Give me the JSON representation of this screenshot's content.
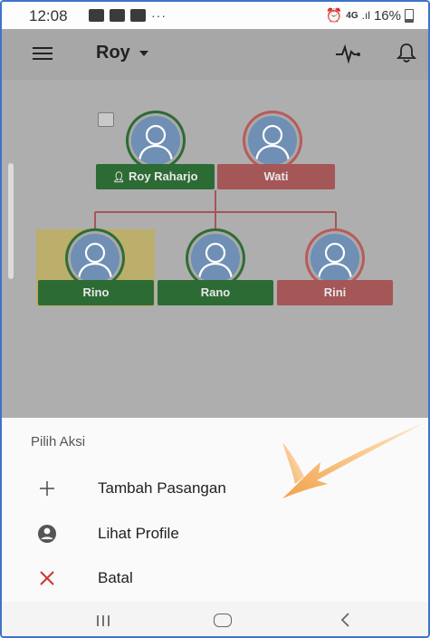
{
  "status_bar": {
    "time": "12:08",
    "network": "4G",
    "battery": "16%"
  },
  "app_bar": {
    "title": "Roy"
  },
  "tree": {
    "parents": [
      {
        "name": "Roy Raharjo",
        "color": "#2d6b35"
      },
      {
        "name": "Wati",
        "color": "#a55656"
      }
    ],
    "children": [
      {
        "name": "Rino",
        "color": "#2d6b35",
        "selected": true
      },
      {
        "name": "Rano",
        "color": "#2d6b35"
      },
      {
        "name": "Rini",
        "color": "#a55656"
      }
    ]
  },
  "sheet": {
    "title": "Pilih Aksi",
    "items": [
      {
        "label": "Tambah Pasangan",
        "icon": "plus-icon"
      },
      {
        "label": "Lihat Profile",
        "icon": "account-circle-icon"
      },
      {
        "label": "Batal",
        "icon": "close-icon"
      }
    ]
  }
}
